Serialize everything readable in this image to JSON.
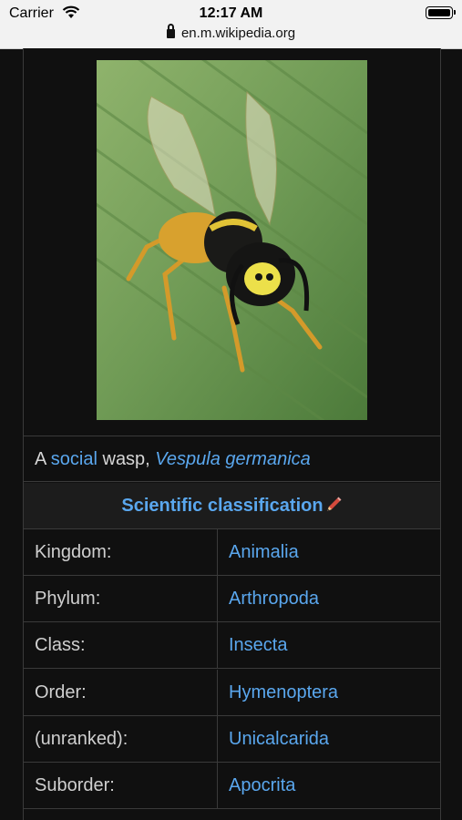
{
  "status_bar": {
    "carrier": "Carrier",
    "time": "12:17 AM"
  },
  "url_bar": {
    "domain": "en.m.wikipedia.org"
  },
  "infobox": {
    "caption": {
      "prefix": "A ",
      "link1": "social",
      "middle": " wasp, ",
      "link2": "Vespula germanica"
    },
    "section_title": "Scientific classification",
    "rows": [
      {
        "label": "Kingdom:",
        "value": "Animalia"
      },
      {
        "label": "Phylum:",
        "value": "Arthropoda"
      },
      {
        "label": "Class:",
        "value": "Insecta"
      },
      {
        "label": "Order:",
        "value": "Hymenoptera"
      },
      {
        "label": "(unranked):",
        "value": "Unicalcarida"
      },
      {
        "label": "Suborder:",
        "value": "Apocrita"
      }
    ]
  },
  "colors": {
    "link": "#5aa7ee",
    "background": "#101010",
    "border": "#3a3a3a",
    "text": "#d6d6d6"
  },
  "icons": [
    "wifi-icon",
    "battery-icon",
    "lock-icon",
    "pencil-icon"
  ]
}
